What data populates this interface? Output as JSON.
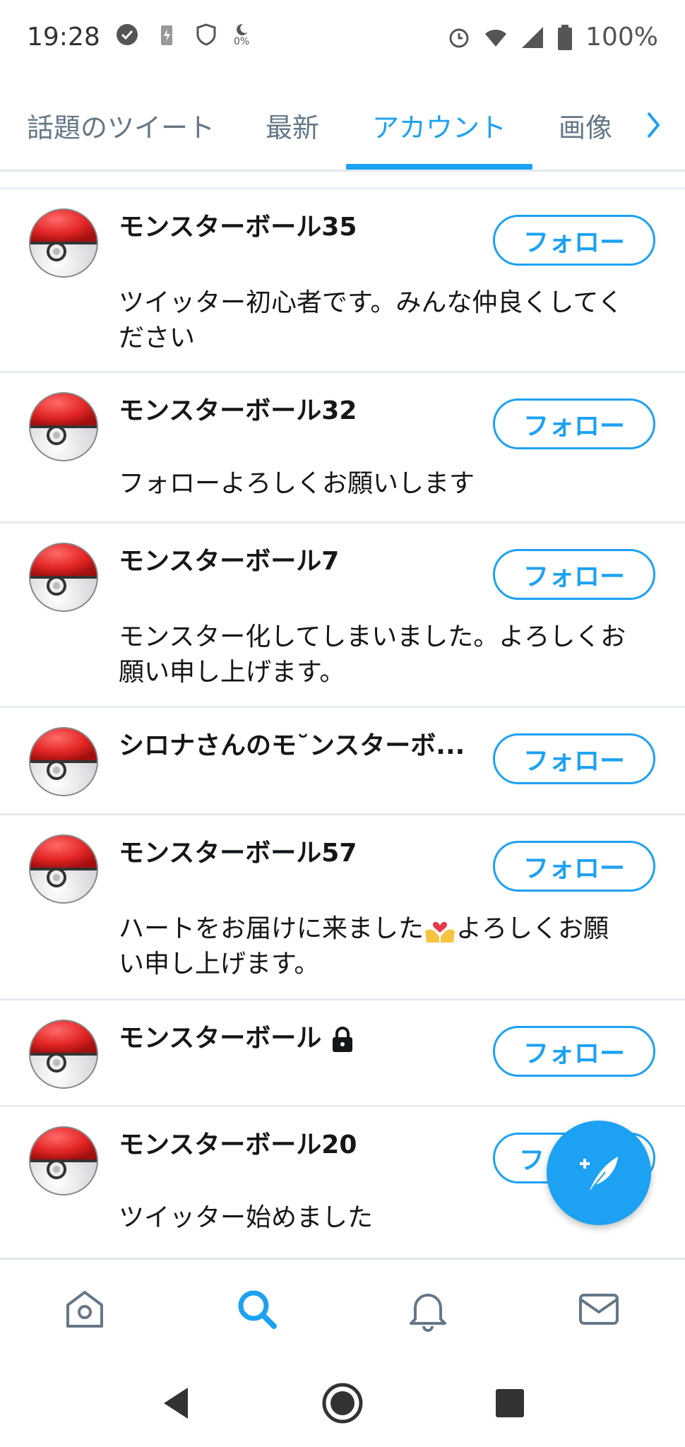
{
  "status_bar": {
    "time": "19:28",
    "battery_text": "100%",
    "mini_percent": "0%",
    "icons_left": [
      "check-circle-icon",
      "battery-charging-icon",
      "shield-icon",
      "moon-icon"
    ],
    "icons_right": [
      "alarm-icon",
      "wifi-icon",
      "signal-icon",
      "battery-icon"
    ]
  },
  "tabs": [
    {
      "label": "話題のツイート",
      "active": false
    },
    {
      "label": "最新",
      "active": false
    },
    {
      "label": "アカウント",
      "active": true
    },
    {
      "label": "画像",
      "active": false
    }
  ],
  "accounts": [
    {
      "name": "モンスターボール35",
      "bio_lines": [
        "ツイッター初心者です。みんな仲良くしてく",
        "ださい"
      ],
      "follow_label": "フォロー"
    },
    {
      "name": "モンスターボール32",
      "bio_lines": [
        "フォローよろしくお願いします"
      ],
      "follow_label": "フォロー"
    },
    {
      "name": "モンスターボール7",
      "bio_lines": [
        "モンスター化してしまいました。よろしくお",
        "願い申し上げます。"
      ],
      "follow_label": "フォロー"
    },
    {
      "name": "シロナさんのモ˘ンスターボ...",
      "bio_lines": [],
      "follow_label": "フォロー"
    },
    {
      "name": "モンスターボール57",
      "bio_lines_rich": {
        "before": "ハートをお届けに来ました",
        "after": "よろしくお願",
        "line2": "い申し上げます。"
      },
      "follow_label": "フォロー"
    },
    {
      "name": "モンスターボール",
      "locked": true,
      "bio_lines": [],
      "follow_label": "フォロー"
    },
    {
      "name": "モンスターボール20",
      "bio_lines": [
        "ツイッター始めました"
      ],
      "follow_label": "フォ"
    }
  ],
  "colors": {
    "accent": "#1da1f2",
    "text": "#14171a",
    "muted": "#657786"
  },
  "bottom_nav": [
    "home-icon",
    "search-icon",
    "bell-icon",
    "mail-icon"
  ],
  "system_nav": [
    "back-icon",
    "home-circle-icon",
    "recents-icon"
  ]
}
